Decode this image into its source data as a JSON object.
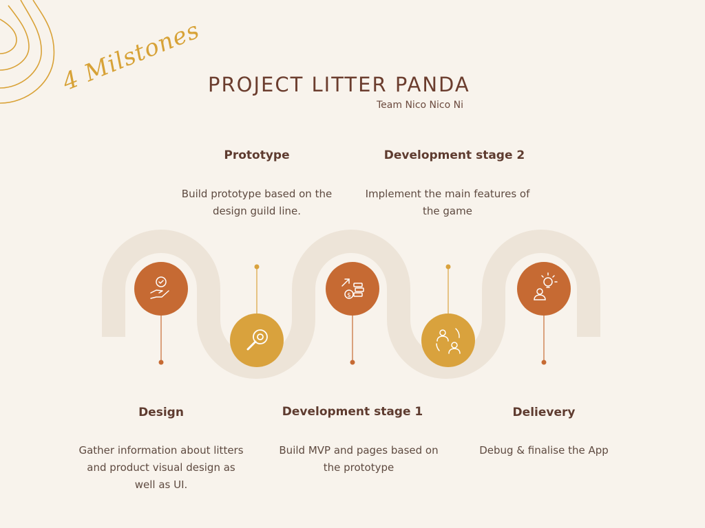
{
  "header": {
    "title": "PROJECT LITTER PANDA",
    "subtitle": "Team Nico Nico Ni",
    "script_label": "4 Milstones"
  },
  "milestones": [
    {
      "heading": "Design",
      "description": "Gather information about litters and product visual design as well as UI.",
      "icon": "hand-heart-icon",
      "color": "#c66a33"
    },
    {
      "heading": "Prototype",
      "description": "Build prototype based on the design guild line.",
      "icon": "magnifier-icon",
      "color": "#d9a23d"
    },
    {
      "heading": "Development stage 1",
      "description": "Build MVP and pages based on the prototype",
      "icon": "money-growth-icon",
      "color": "#c66a33"
    },
    {
      "heading": "Development stage 2",
      "description": "Implement the main features of the game",
      "icon": "user-swap-icon",
      "color": "#d9a23d"
    },
    {
      "heading": "Delievery",
      "description": "Debug & finalise the App",
      "icon": "idea-person-icon",
      "color": "#c66a33"
    }
  ],
  "colors": {
    "background": "#f8f3ec",
    "track": "#ede4d8",
    "dark_orange": "#c66a33",
    "gold": "#d9a23d",
    "title": "#6b3d2e"
  }
}
